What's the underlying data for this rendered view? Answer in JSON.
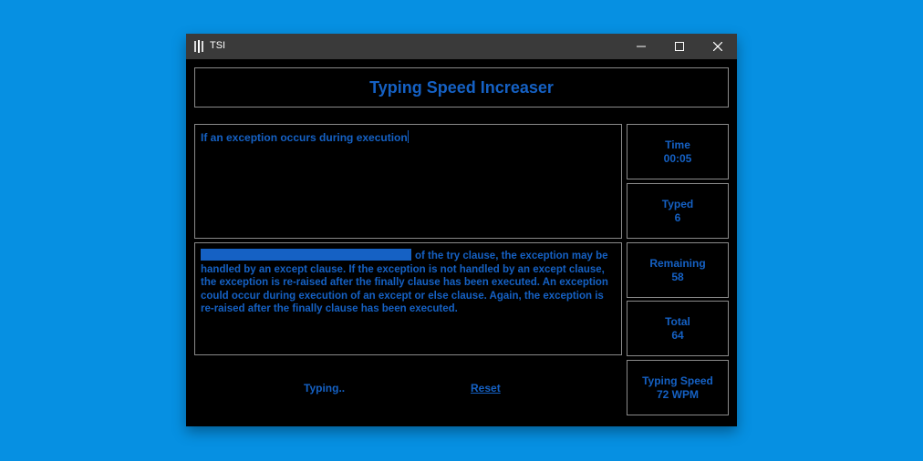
{
  "window": {
    "title": "TSI"
  },
  "app": {
    "heading": "Typing Speed Increaser",
    "typed_input": "If an exception occurs during execution",
    "passage_rest": "of the try clause, the exception may be handled by an except clause. If the exception is not handled by an except clause, the exception is re-raised after the finally clause has been executed. An exception could occur during execution of an except or else clause. Again, the exception is re-raised after the finally clause has been executed.",
    "status": "Typing..",
    "reset_label": "Reset"
  },
  "stats": {
    "time": {
      "label": "Time",
      "value": "00:05"
    },
    "typed": {
      "label": "Typed",
      "value": "6"
    },
    "remaining": {
      "label": "Remaining",
      "value": "58"
    },
    "total": {
      "label": "Total",
      "value": "64"
    },
    "speed": {
      "label": "Typing Speed",
      "value": "72 WPM"
    }
  },
  "colors": {
    "background": "#0690e2",
    "accent": "#1561c4",
    "window": "#000000",
    "titlebar": "#3a3a3a"
  }
}
